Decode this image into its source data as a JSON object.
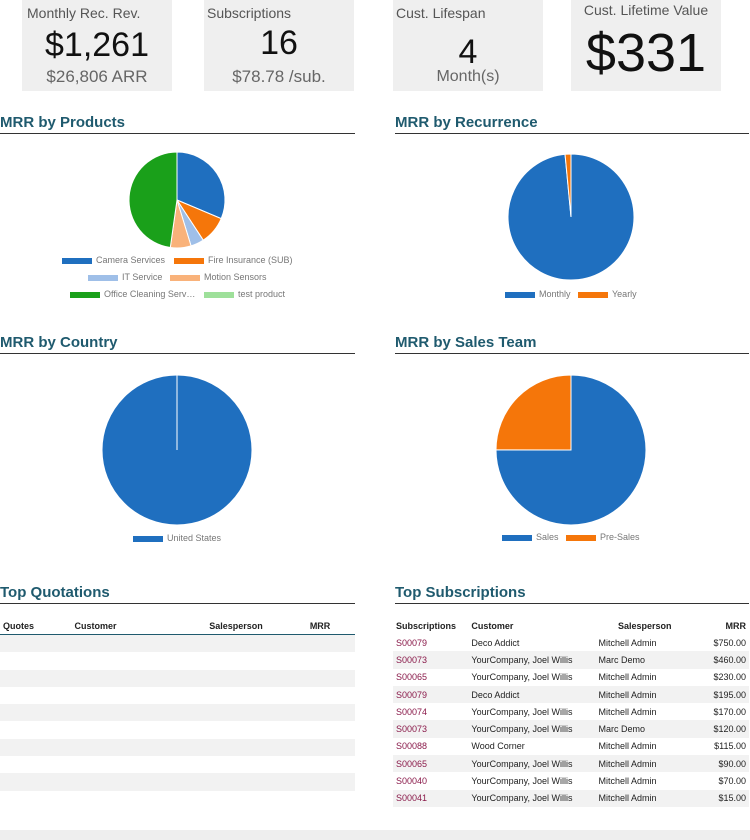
{
  "kpis": [
    {
      "title": "Monthly Rec. Rev.",
      "value": "$1,261",
      "sub": "$26,806 ARR"
    },
    {
      "title": "Subscriptions",
      "value": "16",
      "sub": "$78.78 /sub."
    },
    {
      "title": "Cust. Lifespan",
      "value": "4",
      "sub": "Month(s)"
    },
    {
      "title": "Cust. Lifetime Value",
      "value": "$331",
      "sub": ""
    }
  ],
  "sections": {
    "products": "MRR by Products",
    "recurrence": "MRR by Recurrence",
    "country": "MRR by Country",
    "team": "MRR by Sales Team",
    "quotations": "Top Quotations",
    "subscriptions": "Top Subscriptions"
  },
  "chart_data": [
    {
      "type": "pie",
      "title": "MRR by Products",
      "categories": [
        "Camera Services",
        "Fire Insurance (SUB)",
        "IT Service",
        "Motion Sensors",
        "Office Cleaning Serv…",
        "test product"
      ],
      "values": [
        315,
        95,
        45,
        70,
        480,
        0
      ],
      "colors": [
        "#1f6fbf",
        "#f5760a",
        "#9fbfe8",
        "#f9b27a",
        "#1aa01a",
        "#9ee09a"
      ]
    },
    {
      "type": "pie",
      "title": "MRR by Recurrence",
      "categories": [
        "Monthly",
        "Yearly"
      ],
      "values": [
        1242,
        19
      ],
      "colors": [
        "#1f6fbf",
        "#f5760a"
      ]
    },
    {
      "type": "pie",
      "title": "MRR by Country",
      "categories": [
        "United States"
      ],
      "values": [
        1261
      ],
      "colors": [
        "#1f6fbf"
      ]
    },
    {
      "type": "pie",
      "title": "MRR by Sales Team",
      "categories": [
        "Sales",
        "Pre-Sales"
      ],
      "values": [
        946,
        315
      ],
      "colors": [
        "#1f6fbf",
        "#f5760a"
      ]
    }
  ],
  "quotations": {
    "headers": [
      "Quotes",
      "Customer",
      "Salesperson",
      "MRR"
    ],
    "rows": []
  },
  "subscriptions": {
    "headers": [
      "Subscriptions",
      "Customer",
      "Salesperson",
      "MRR"
    ],
    "rows": [
      [
        "S00079",
        "Deco Addict",
        "Mitchell Admin",
        "$750.00"
      ],
      [
        "S00073",
        "YourCompany, Joel Willis",
        "Marc Demo",
        "$460.00"
      ],
      [
        "S00065",
        "YourCompany, Joel Willis",
        "Mitchell Admin",
        "$230.00"
      ],
      [
        "S00079",
        "Deco Addict",
        "Mitchell Admin",
        "$195.00"
      ],
      [
        "S00074",
        "YourCompany, Joel Willis",
        "Mitchell Admin",
        "$170.00"
      ],
      [
        "S00073",
        "YourCompany, Joel Willis",
        "Marc Demo",
        "$120.00"
      ],
      [
        "S00088",
        "Wood Corner",
        "Mitchell Admin",
        "$115.00"
      ],
      [
        "S00065",
        "YourCompany, Joel Willis",
        "Mitchell Admin",
        "$90.00"
      ],
      [
        "S00040",
        "YourCompany, Joel Willis",
        "Mitchell Admin",
        "$70.00"
      ],
      [
        "S00041",
        "YourCompany, Joel Willis",
        "Mitchell Admin",
        "$15.00"
      ]
    ]
  }
}
